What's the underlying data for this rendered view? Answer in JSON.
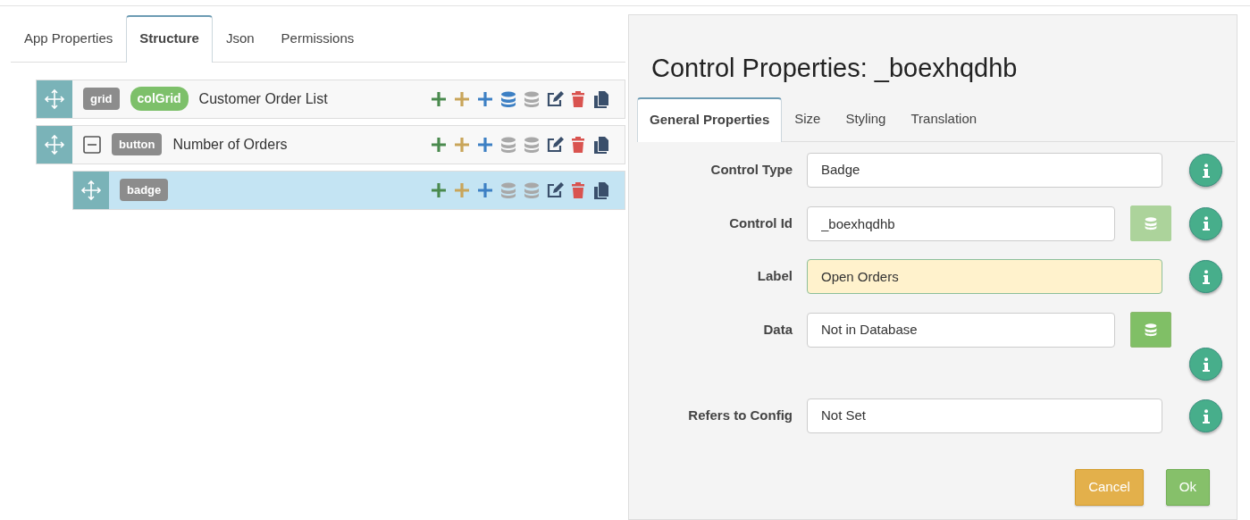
{
  "left_tabs": [
    {
      "label": "App Properties",
      "selected": false
    },
    {
      "label": "Structure",
      "selected": true
    },
    {
      "label": "Json",
      "selected": false
    },
    {
      "label": "Permissions",
      "selected": false
    }
  ],
  "tree": [
    {
      "tags": [
        {
          "text": "grid",
          "kind": "tag",
          "color": "#8c8c8c"
        },
        {
          "text": "colGrid",
          "kind": "pill",
          "color": "#7dc06a"
        }
      ],
      "label": "Customer Order List",
      "selected": false,
      "actions": [
        {
          "kind": "plus",
          "color": "#4a8a4e"
        },
        {
          "kind": "plus",
          "color": "#c9a55a"
        },
        {
          "kind": "plus",
          "color": "#3d80c4"
        },
        {
          "kind": "database",
          "color": "#3d80c4"
        },
        {
          "kind": "database",
          "color": "#a8a8a8"
        },
        {
          "kind": "edit",
          "color": "#3a4f6b"
        },
        {
          "kind": "trash",
          "color": "#d9534f"
        },
        {
          "kind": "copy",
          "color": "#3a4f6b"
        }
      ]
    },
    {
      "tags": [
        {
          "text": "button",
          "kind": "tag",
          "color": "#8c8c8c"
        }
      ],
      "label": "Number of Orders",
      "selected": false,
      "expanded": true,
      "actions": [
        {
          "kind": "plus",
          "color": "#4a8a4e"
        },
        {
          "kind": "plus",
          "color": "#c9a55a"
        },
        {
          "kind": "plus",
          "color": "#3d80c4"
        },
        {
          "kind": "database",
          "color": "#a8a8a8"
        },
        {
          "kind": "database",
          "color": "#a8a8a8"
        },
        {
          "kind": "edit",
          "color": "#3a4f6b"
        },
        {
          "kind": "trash",
          "color": "#d9534f"
        },
        {
          "kind": "copy",
          "color": "#3a4f6b"
        }
      ],
      "children": [
        {
          "tags": [
            {
              "text": "badge",
              "kind": "tag",
              "color": "#8c8c8c"
            }
          ],
          "selected": true,
          "actions": [
            {
              "kind": "plus",
              "color": "#4a8a4e"
            },
            {
              "kind": "plus",
              "color": "#c9a55a"
            },
            {
              "kind": "plus",
              "color": "#3d80c4"
            },
            {
              "kind": "database",
              "color": "#a8a8a8"
            },
            {
              "kind": "database",
              "color": "#a8a8a8"
            },
            {
              "kind": "edit",
              "color": "#3a4f6b"
            },
            {
              "kind": "trash",
              "color": "#d9534f"
            },
            {
              "kind": "copy",
              "color": "#3a4f6b"
            }
          ]
        }
      ]
    }
  ],
  "dialog": {
    "title": "Control Properties: _boexhqdhb",
    "tabs": [
      {
        "label": "General Properties",
        "selected": true
      },
      {
        "label": "Size",
        "selected": false
      },
      {
        "label": "Styling",
        "selected": false
      },
      {
        "label": "Translation",
        "selected": false
      }
    ],
    "fields": [
      {
        "label": "Control Type",
        "kind": "select",
        "value": "Badge",
        "focused": false
      },
      {
        "label": "Control Id",
        "kind": "text",
        "value": "_boexhqdhb",
        "focused": false,
        "db_button": {
          "enabled": false
        }
      },
      {
        "label": "Label",
        "kind": "text",
        "value": "Open Orders",
        "focused": true
      },
      {
        "label": "Data",
        "kind": "select",
        "value": "Not in Database",
        "focused": false,
        "db_button": {
          "enabled": true
        }
      },
      {
        "label": "Refers to Config",
        "kind": "select",
        "value": "Not Set",
        "focused": false
      }
    ],
    "buttons": [
      {
        "label": "Cancel",
        "kind": "cancel"
      },
      {
        "label": "Ok",
        "kind": "ok"
      }
    ]
  }
}
